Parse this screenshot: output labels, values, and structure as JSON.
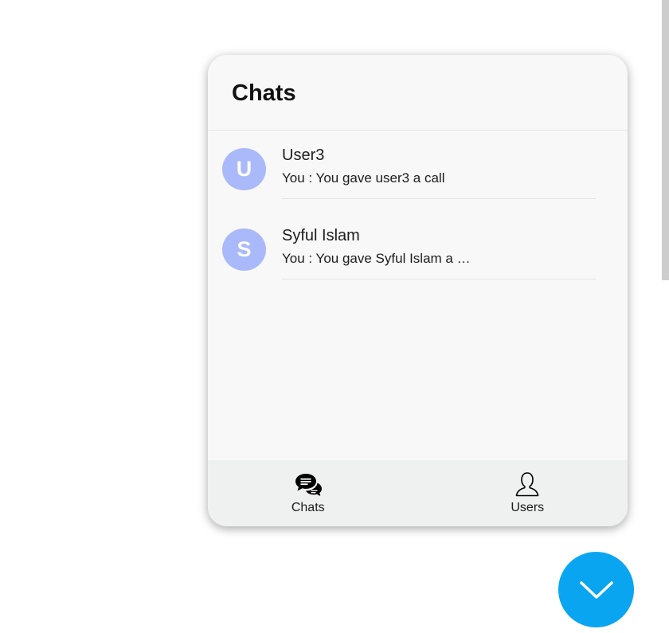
{
  "chat_widget": {
    "title": "Chats",
    "chats": [
      {
        "avatar_letter": "U",
        "name": "User3",
        "preview": "You : You gave user3 a call"
      },
      {
        "avatar_letter": "S",
        "name": "Syful Islam",
        "preview": "You : You gave Syful Islam a …"
      }
    ],
    "nav": {
      "chats_label": "Chats",
      "chats_icon": "chat-bubbles-icon",
      "users_label": "Users",
      "users_icon": "user-icon"
    }
  },
  "fab": {
    "icon": "chevron-down-icon",
    "color": "#0aa5f1"
  },
  "colors": {
    "avatar": "#a9b9f9",
    "widget_background": "#f8f8f8",
    "nav_background": "#eff0f0"
  }
}
